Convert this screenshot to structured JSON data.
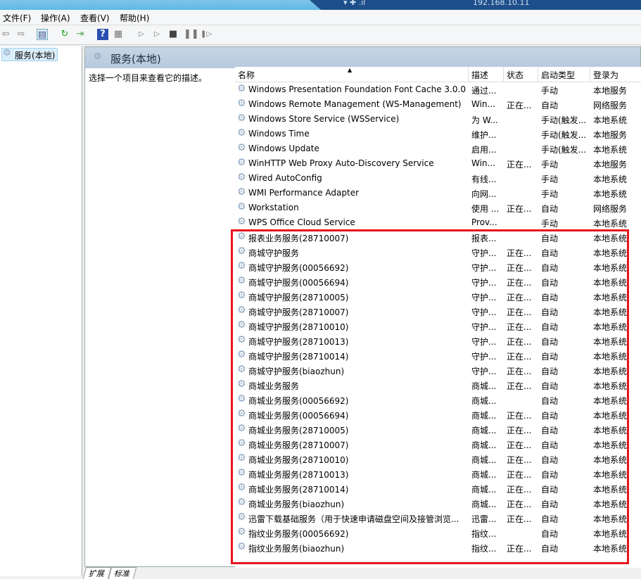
{
  "titlebar": {
    "remote_ip": "192.168.10.11"
  },
  "menu": [
    "文件(F)",
    "操作(A)",
    "查看(V)",
    "帮助(H)"
  ],
  "toolbar": {
    "icons": [
      "back-icon",
      "forward-icon",
      "show-hide-tree-icon",
      "refresh-icon",
      "export-list-icon",
      "help-icon",
      "properties-icon",
      "start-icon",
      "start-alt-icon",
      "stop-icon",
      "pause-icon",
      "resume-icon"
    ]
  },
  "tree": {
    "item": "服务(本地)"
  },
  "pane": {
    "title": "服务(本地)",
    "description": "选择一个项目来查看它的描述。"
  },
  "columns": [
    "名称",
    "描述",
    "状态",
    "启动类型",
    "登录为"
  ],
  "rows": [
    [
      "Windows Presentation Foundation Font Cache 3.0.0.0",
      "通过...",
      "",
      "手动",
      "本地服务"
    ],
    [
      "Windows Remote Management (WS-Management)",
      "Win...",
      "正在...",
      "自动",
      "网络服务"
    ],
    [
      "Windows Store Service (WSService)",
      "为 W...",
      "",
      "手动(触发...",
      "本地系统"
    ],
    [
      "Windows Time",
      "维护...",
      "",
      "手动(触发...",
      "本地服务"
    ],
    [
      "Windows Update",
      "启用...",
      "",
      "手动(触发...",
      "本地系统"
    ],
    [
      "WinHTTP Web Proxy Auto-Discovery Service",
      "Win...",
      "正在...",
      "手动",
      "本地服务"
    ],
    [
      "Wired AutoConfig",
      "有线...",
      "",
      "手动",
      "本地系统"
    ],
    [
      "WMI Performance Adapter",
      "向网...",
      "",
      "手动",
      "本地系统"
    ],
    [
      "Workstation",
      "使用 ...",
      "正在...",
      "自动",
      "网络服务"
    ],
    [
      "WPS Office Cloud Service",
      "Prov...",
      "",
      "手动",
      "本地系统"
    ],
    [
      "报表业务服务(28710007)",
      "报表...",
      "",
      "自动",
      "本地系统"
    ],
    [
      "商城守护服务",
      "守护...",
      "正在...",
      "自动",
      "本地系统"
    ],
    [
      "商城守护服务(00056692)",
      "守护...",
      "正在...",
      "自动",
      "本地系统"
    ],
    [
      "商城守护服务(00056694)",
      "守护...",
      "正在...",
      "自动",
      "本地系统"
    ],
    [
      "商城守护服务(28710005)",
      "守护...",
      "正在...",
      "自动",
      "本地系统"
    ],
    [
      "商城守护服务(28710007)",
      "守护...",
      "正在...",
      "自动",
      "本地系统"
    ],
    [
      "商城守护服务(28710010)",
      "守护...",
      "正在...",
      "自动",
      "本地系统"
    ],
    [
      "商城守护服务(28710013)",
      "守护...",
      "正在...",
      "自动",
      "本地系统"
    ],
    [
      "商城守护服务(28710014)",
      "守护...",
      "正在...",
      "自动",
      "本地系统"
    ],
    [
      "商城守护服务(biaozhun)",
      "守护...",
      "正在...",
      "自动",
      "本地系统"
    ],
    [
      "商城业务服务",
      "商城...",
      "正在...",
      "自动",
      "本地系统"
    ],
    [
      "商城业务服务(00056692)",
      "商城...",
      "",
      "自动",
      "本地系统"
    ],
    [
      "商城业务服务(00056694)",
      "商城...",
      "正在...",
      "自动",
      "本地系统"
    ],
    [
      "商城业务服务(28710005)",
      "商城...",
      "正在...",
      "自动",
      "本地系统"
    ],
    [
      "商城业务服务(28710007)",
      "商城...",
      "正在...",
      "自动",
      "本地系统"
    ],
    [
      "商城业务服务(28710010)",
      "商城...",
      "正在...",
      "自动",
      "本地系统"
    ],
    [
      "商城业务服务(28710013)",
      "商城...",
      "正在...",
      "自动",
      "本地系统"
    ],
    [
      "商城业务服务(28710014)",
      "商城...",
      "正在...",
      "自动",
      "本地系统"
    ],
    [
      "商城业务服务(biaozhun)",
      "商城...",
      "正在...",
      "自动",
      "本地系统"
    ],
    [
      "迅雷下载基础服务（用于快速申请磁盘空间及接管浏览...",
      "迅雷...",
      "正在...",
      "自动",
      "本地系统"
    ],
    [
      "指纹业务服务(00056692)",
      "指纹...",
      "",
      "自动",
      "本地系统"
    ],
    [
      "指纹业务服务(biaozhun)",
      "指纹...",
      "正在...",
      "自动",
      "本地系统"
    ]
  ],
  "highlight_color": "#e8141c",
  "tabs": [
    "扩展",
    "标准"
  ]
}
